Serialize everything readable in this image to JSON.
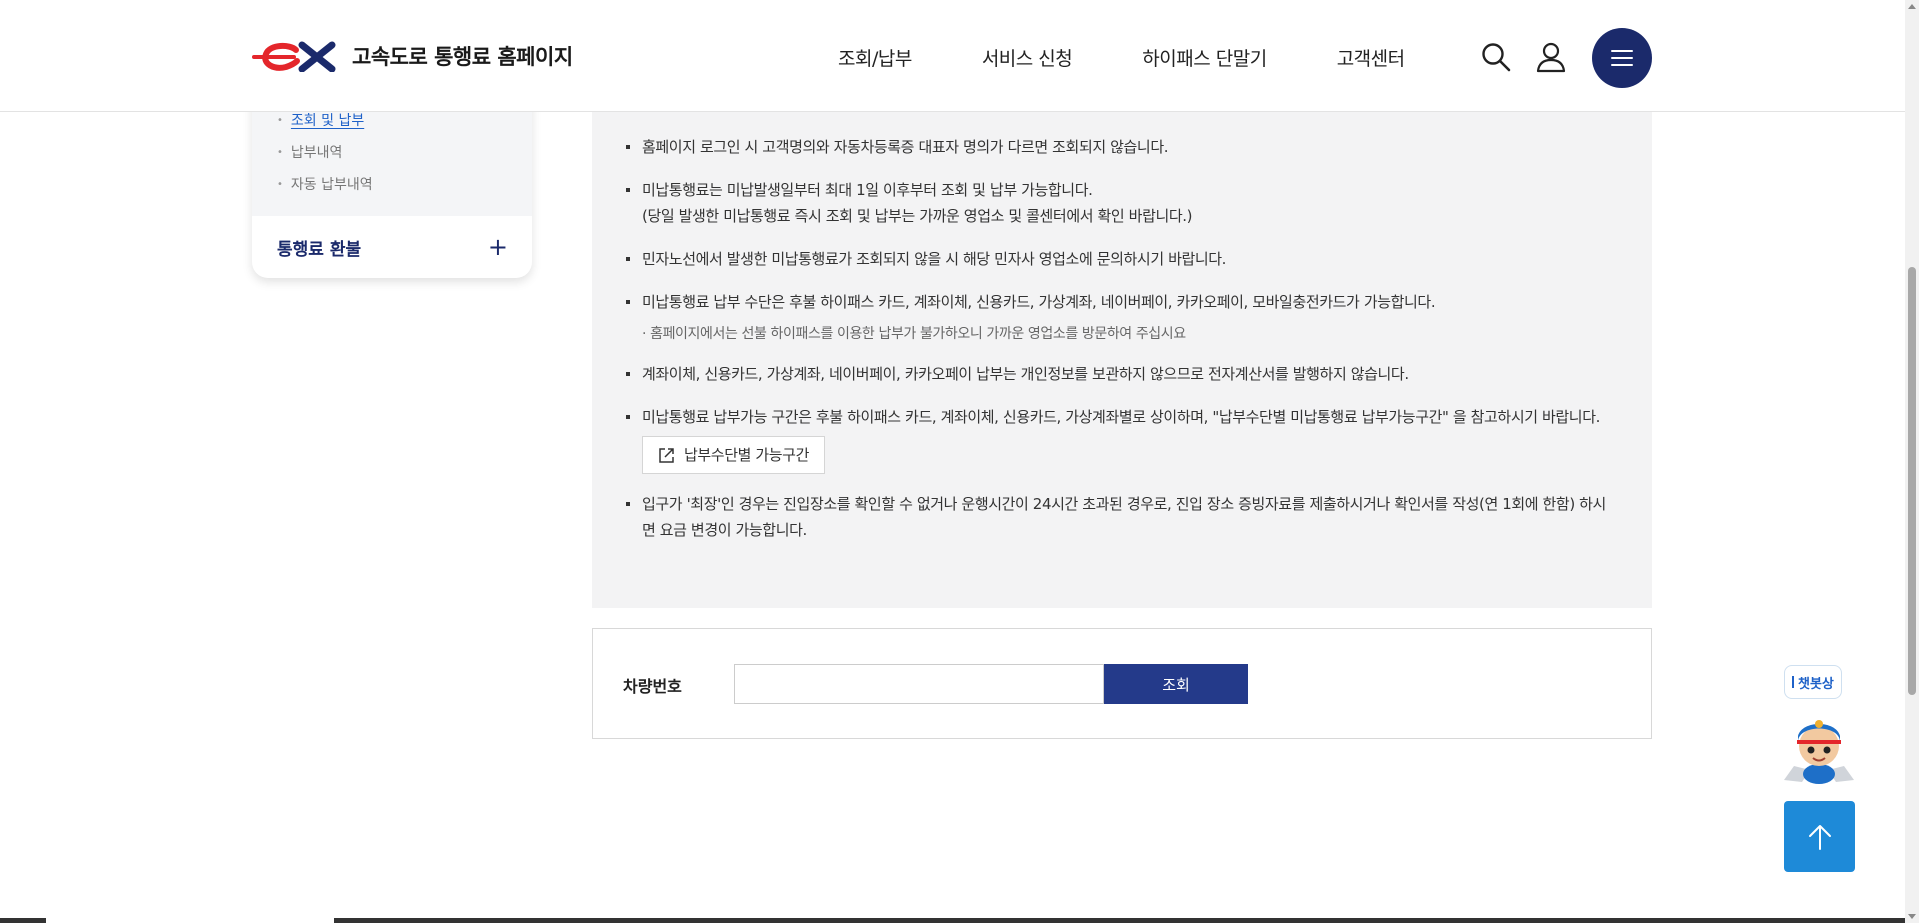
{
  "header": {
    "logo_text": "고속도로 통행료 홈페이지",
    "nav": [
      "조회/납부",
      "서비스 신청",
      "하이패스 단말기",
      "고객센터"
    ]
  },
  "sidebar": {
    "sub_items": [
      {
        "label": "조회 및 납부",
        "active": true
      },
      {
        "label": "납부내역",
        "active": false
      },
      {
        "label": "자동 납부내역",
        "active": false
      }
    ],
    "section_label": "통행료 환불"
  },
  "notice": {
    "items": [
      {
        "text": "홈페이지 로그인 시 고객명의와 자동차등록증 대표자 명의가 다르면 조회되지 않습니다."
      },
      {
        "text": "미납통행료는 미납발생일부터 최대 1일 이후부터 조회 및 납부 가능합니다.",
        "text2": "(당일 발생한 미납통행료 즉시 조회 및 납부는 가까운 영업소 및 콜센터에서 확인 바랍니다.)"
      },
      {
        "text": "민자노선에서 발생한 미납통행료가 조회되지 않을 시 해당 민자사 영업소에 문의하시기 바랍니다."
      },
      {
        "text": "미납통행료 납부 수단은 후불 하이패스 카드, 계좌이체, 신용카드, 가상계좌, 네이버페이, 카카오페이, 모바일충전카드가 가능합니다.",
        "note": "· 홈페이지에서는 선불 하이패스를 이용한 납부가 불가하오니 가까운 영업소를 방문하여 주십시요"
      },
      {
        "text": "계좌이체, 신용카드, 가상계좌, 네이버페이, 카카오페이 납부는 개인정보를 보관하지 않으므로 전자계산서를 발행하지 않습니다."
      },
      {
        "text": "미납통행료 납부가능 구간은 후불 하이패스 카드, 계좌이체, 신용카드, 가상계좌별로 상이하며, \"납부수단별 미납통행료 납부가능구간\" 을 참고하시기 바랍니다.",
        "button": "납부수단별 가능구간"
      },
      {
        "text": "입구가 '최장'인 경우는 진입장소를 확인할 수 없거나 운행시간이 24시간 초과된 경우로, 진입 장소 증빙자료를 제출하시거나 확인서를 작성(연 1회에 한함) 하시면 요금 변경이 가능합니다."
      }
    ]
  },
  "form": {
    "label": "차량번호",
    "input_value": "",
    "submit_label": "조회"
  },
  "floating": {
    "chatbot_label": "챗봇상"
  },
  "colors": {
    "brand_navy": "#1b2a6b",
    "button_blue": "#243a8a",
    "top_button": "#1e8ad8",
    "logo_red": "#e4262b"
  }
}
